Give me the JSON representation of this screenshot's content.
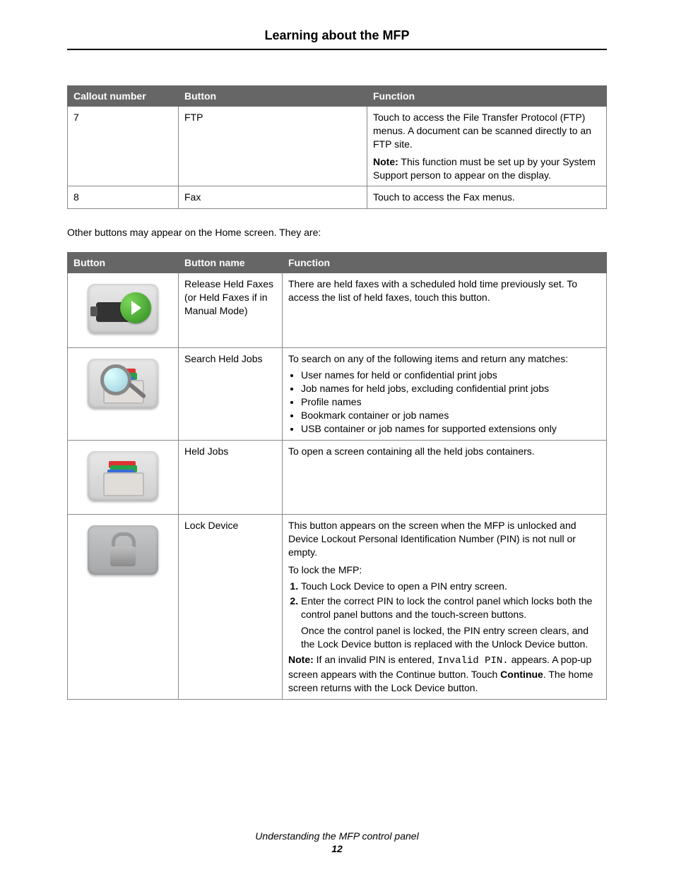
{
  "page_title": "Learning about the MFP",
  "footer": {
    "section": "Understanding the MFP control panel",
    "page_number": "12"
  },
  "table1": {
    "headers": {
      "callout": "Callout number",
      "button": "Button",
      "function": "Function"
    },
    "rows": [
      {
        "callout": "7",
        "button": "FTP",
        "function_p1": "Touch to access the File Transfer Protocol (FTP) menus. A document can be scanned directly to an FTP site.",
        "note_label": "Note:",
        "note_text": " This function must be set up by your System Support person to appear on the display."
      },
      {
        "callout": "8",
        "button": "Fax",
        "function_p1": "Touch to access the Fax menus."
      }
    ]
  },
  "intro_text": "Other buttons may appear on the Home screen. They are:",
  "table2": {
    "headers": {
      "button": "Button",
      "name": "Button name",
      "function": "Function"
    },
    "rows": {
      "release": {
        "name": "Release Held Faxes (or Held Faxes if in Manual Mode)",
        "function": "There are held faxes with a scheduled hold time previously set. To access the list of held faxes, touch this button."
      },
      "search": {
        "name": "Search Held Jobs",
        "lead": "To search on any of the following items and return any matches:",
        "bullets": [
          "User names for held or confidential print jobs",
          "Job names for held jobs, excluding confidential print jobs",
          "Profile names",
          "Bookmark container or job names",
          "USB container or job names for supported extensions only"
        ]
      },
      "held": {
        "name": "Held Jobs",
        "function": "To open a screen containing all the held jobs containers."
      },
      "lock": {
        "name": "Lock Device",
        "p1": "This button appears on the screen when the MFP is unlocked and Device Lockout Personal Identification Number (PIN) is not null or empty.",
        "p2": "To lock the MFP:",
        "step1_pre": "Touch ",
        "step1_bold": "Lock Device",
        "step1_post": " to open a PIN entry screen.",
        "step2": "Enter the correct PIN to lock the control panel which locks both the control panel buttons and the touch-screen buttons.",
        "step2_sub": "Once the control panel is locked, the PIN entry screen clears, and the Lock Device button is replaced with the Unlock Device button.",
        "note_label": "Note:",
        "note_a": " If an invalid PIN is entered, ",
        "note_code": "Invalid PIN.",
        "note_b": " appears. A pop-up screen appears with the Continue button. Touch ",
        "note_bold": "Continue",
        "note_c": ". The home screen returns with the Lock Device button."
      }
    }
  }
}
